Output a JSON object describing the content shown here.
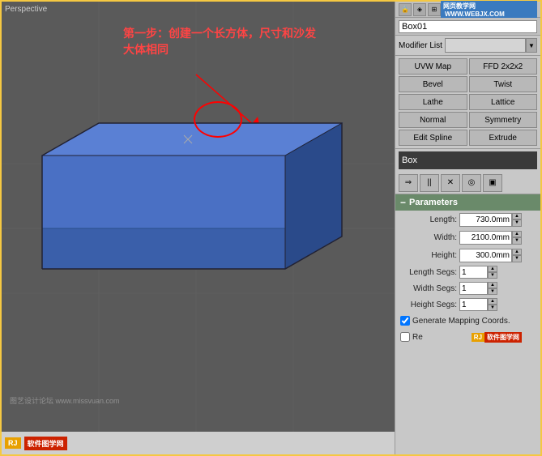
{
  "viewport": {
    "label": "Perspective",
    "watermark": "图艺设计论坛 www.missvuan.com"
  },
  "annotation": {
    "text_line1": "第一步：创建一个长方体，尺寸和沙发",
    "text_line2": "大体相同"
  },
  "panel": {
    "object_name": "Box01",
    "modifier_list_label": "Modifier List",
    "modifier_stack_item": "Box",
    "buttons": [
      {
        "label": "UVW Map",
        "id": "uvw-map"
      },
      {
        "label": "FFD 2x2x2",
        "id": "ffd"
      },
      {
        "label": "Bevel",
        "id": "bevel"
      },
      {
        "label": "Twist",
        "id": "twist"
      },
      {
        "label": "Lathe",
        "id": "lathe"
      },
      {
        "label": "Lattice",
        "id": "lattice"
      },
      {
        "label": "Normal",
        "id": "normal"
      },
      {
        "label": "Symmetry",
        "id": "symmetry"
      },
      {
        "label": "Edit Spline",
        "id": "edit-spline"
      },
      {
        "label": "Extrude",
        "id": "extrude"
      }
    ],
    "parameters": {
      "header": "Parameters",
      "length_label": "Length:",
      "length_value": "730.0mm",
      "width_label": "Width:",
      "width_value": "2100.0mm",
      "height_label": "Height:",
      "height_value": "300.0mm",
      "length_segs_label": "Length Segs:",
      "length_segs_value": "1",
      "width_segs_label": "Width Segs:",
      "width_segs_value": "1",
      "height_segs_label": "Height Segs:",
      "height_segs_value": "1",
      "generate_mapping": "Generate Mapping Coords.",
      "real_world": "Re"
    },
    "icons": [
      "⇒",
      "||",
      "✕",
      "◎",
      "▣"
    ],
    "top_icons": [
      "🔒",
      "◈",
      "⊞"
    ]
  },
  "website": {
    "top_badge": "网页教学网",
    "top_url": "WWW.WEBJX.COM",
    "bottom_badge": "软件图学网",
    "bottom_prefix": "RJ"
  }
}
